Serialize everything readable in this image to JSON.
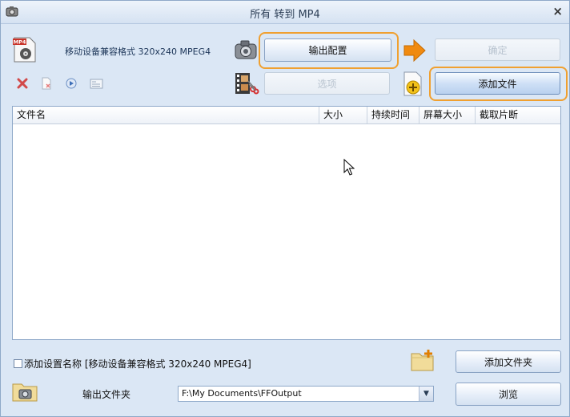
{
  "window": {
    "title": "所有 转到 MP4",
    "close_glyph": "×"
  },
  "profile": {
    "badge_text": "MP4",
    "label": "移动设备兼容格式 320x240 MPEG4"
  },
  "buttons": {
    "output_config": "输出配置",
    "ok": "确定",
    "options": "选项",
    "add_file": "添加文件",
    "add_folder": "添加文件夹",
    "browse": "浏览"
  },
  "toolbar_icons": [
    "delete-icon",
    "clear-list-icon",
    "play-icon",
    "info-icon"
  ],
  "file_list": {
    "columns": [
      "文件名",
      "大小",
      "持续时间",
      "屏幕大小",
      "截取片断"
    ],
    "rows": []
  },
  "bottom": {
    "add_setting_name_label": "添加设置名称 [移动设备兼容格式 320x240 MPEG4]",
    "add_setting_name_checked": false,
    "output_folder_label": "输出文件夹",
    "output_path": "F:\\My Documents\\FFOutput"
  },
  "colors": {
    "window_bg": "#dbe7f5",
    "highlight": "#f0a030",
    "arrow": "#f08a10"
  }
}
